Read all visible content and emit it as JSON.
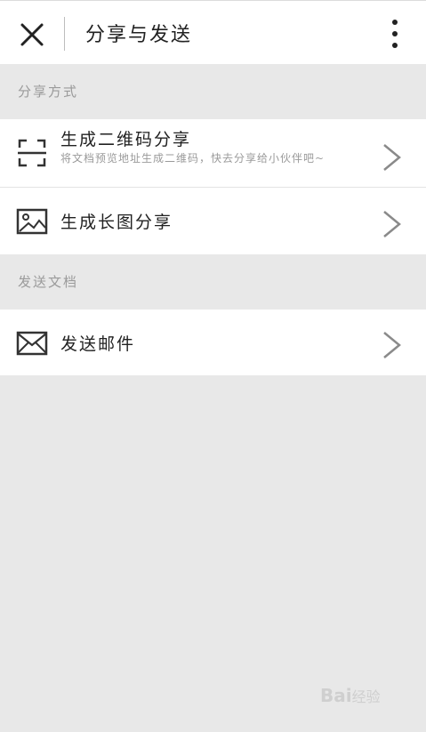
{
  "header": {
    "title": "分享与发送"
  },
  "sections": [
    {
      "title": "分享方式",
      "items": [
        {
          "label": "生成二维码分享",
          "sublabel": "将文档预览地址生成二维码，快去分享给小伙伴吧~",
          "icon": "qr-scan-icon"
        },
        {
          "label": "生成长图分享",
          "icon": "image-icon"
        }
      ]
    },
    {
      "title": "发送文档",
      "items": [
        {
          "label": "发送邮件",
          "icon": "mail-icon"
        }
      ]
    }
  ],
  "watermark": {
    "text": "Bai",
    "suffix": "经验"
  },
  "colors": {
    "background": "#e8e8e8",
    "surface": "#ffffff",
    "text": "#222222",
    "muted": "#9a9a9a",
    "chevron": "#8a8a8a"
  }
}
